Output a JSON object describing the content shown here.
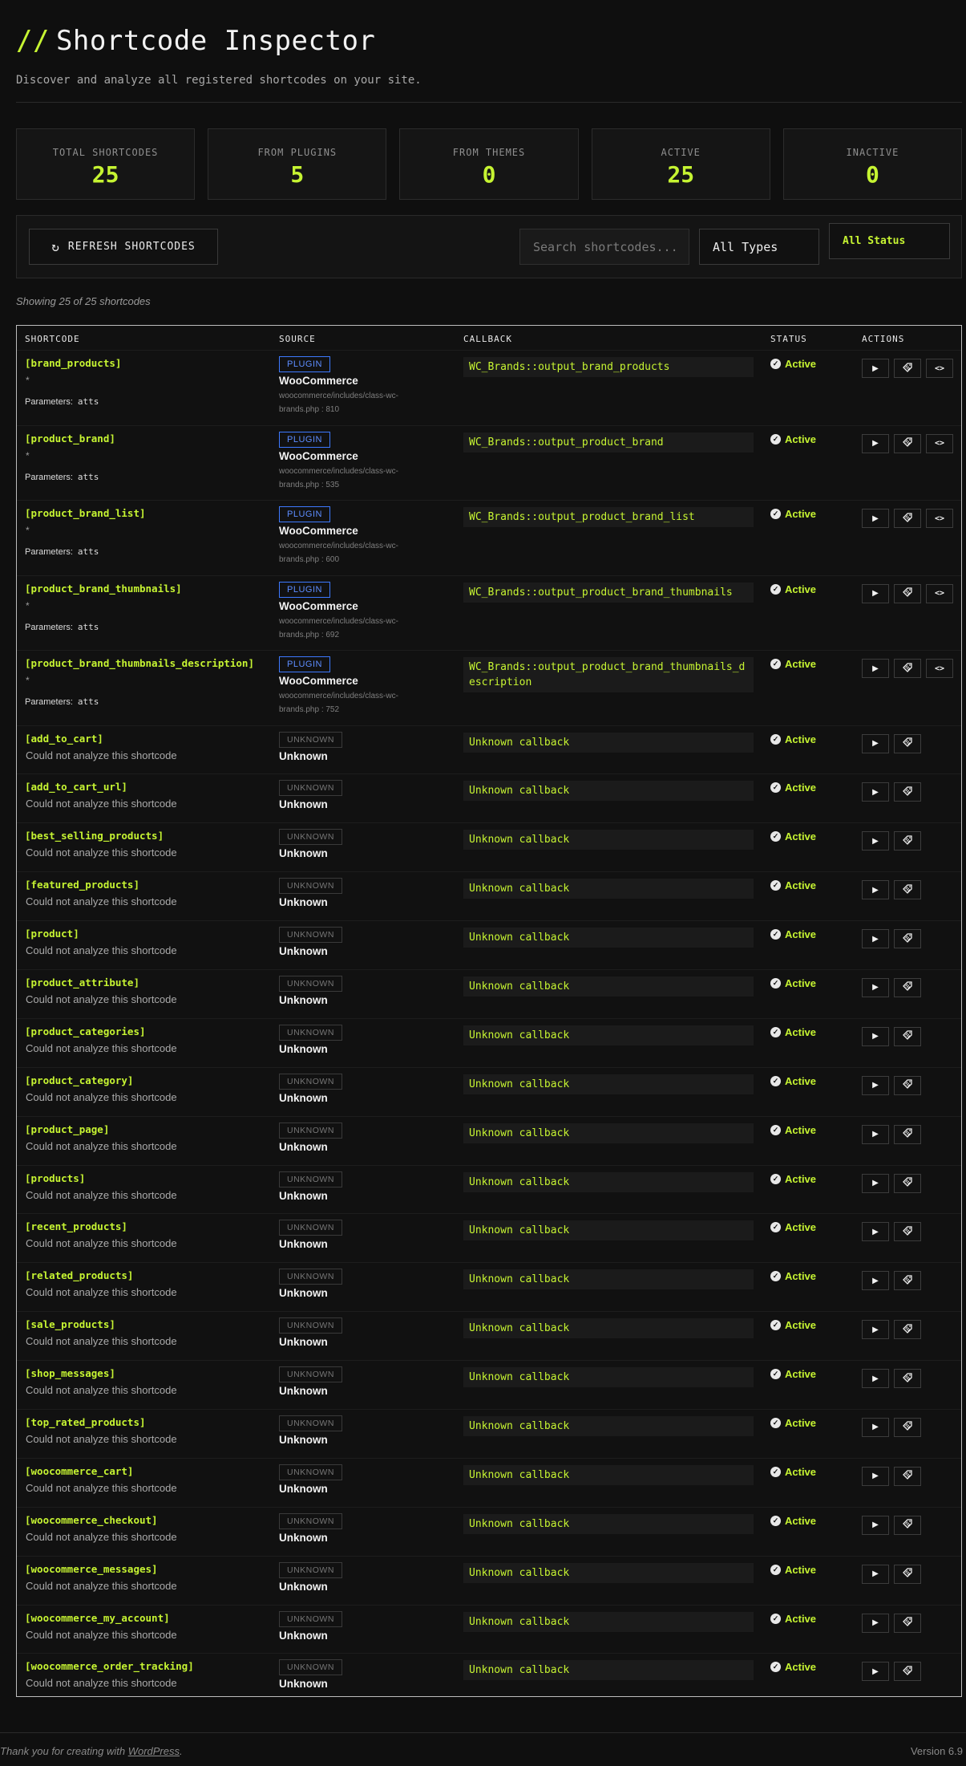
{
  "header": {
    "title_prefix": "//",
    "title": "Shortcode Inspector",
    "subtitle": "Discover and analyze all registered shortcodes on your site."
  },
  "stats": [
    {
      "label": "TOTAL SHORTCODES",
      "value": "25"
    },
    {
      "label": "FROM PLUGINS",
      "value": "5"
    },
    {
      "label": "FROM THEMES",
      "value": "0"
    },
    {
      "label": "ACTIVE",
      "value": "25"
    },
    {
      "label": "INACTIVE",
      "value": "0"
    }
  ],
  "toolbar": {
    "refresh_label": "REFRESH SHORTCODES",
    "search_placeholder": "Search shortcodes...",
    "type_filter": "All Types",
    "status_filter": "All Status"
  },
  "showing": "Showing 25 of 25 shortcodes",
  "table": {
    "columns": [
      "SHORTCODE",
      "SOURCE",
      "CALLBACK",
      "STATUS",
      "ACTIONS"
    ],
    "rows": [
      {
        "name": "[brand_products]",
        "star": "*",
        "params_label": "Parameters:",
        "params": "atts",
        "badge": "PLUGIN",
        "source": "WooCommerce",
        "path": "woocommerce/includes/class-wc-brands.php : 810",
        "callback": "WC_Brands::output_brand_products",
        "status": "Active"
      },
      {
        "name": "[product_brand]",
        "star": "*",
        "params_label": "Parameters:",
        "params": "atts",
        "badge": "PLUGIN",
        "source": "WooCommerce",
        "path": "woocommerce/includes/class-wc-brands.php : 535",
        "callback": "WC_Brands::output_product_brand",
        "status": "Active"
      },
      {
        "name": "[product_brand_list]",
        "star": "*",
        "params_label": "Parameters:",
        "params": "atts",
        "badge": "PLUGIN",
        "source": "WooCommerce",
        "path": "woocommerce/includes/class-wc-brands.php : 600",
        "callback": "WC_Brands::output_product_brand_list",
        "status": "Active"
      },
      {
        "name": "[product_brand_thumbnails]",
        "star": "*",
        "params_label": "Parameters:",
        "params": "atts",
        "badge": "PLUGIN",
        "source": "WooCommerce",
        "path": "woocommerce/includes/class-wc-brands.php : 692",
        "callback": "WC_Brands::output_product_brand_thumbnails",
        "status": "Active"
      },
      {
        "name": "[product_brand_thumbnails_description]",
        "star": "*",
        "params_label": "Parameters:",
        "params": "atts",
        "badge": "PLUGIN",
        "source": "WooCommerce",
        "path": "woocommerce/includes/class-wc-brands.php : 752",
        "callback": "WC_Brands::output_product_brand_thumbnails_description",
        "status": "Active"
      },
      {
        "name": "[add_to_cart]",
        "note": "Could not analyze this shortcode",
        "badge": "UNKNOWN",
        "source": "Unknown",
        "callback": "Unknown callback",
        "status": "Active"
      },
      {
        "name": "[add_to_cart_url]",
        "note": "Could not analyze this shortcode",
        "badge": "UNKNOWN",
        "source": "Unknown",
        "callback": "Unknown callback",
        "status": "Active"
      },
      {
        "name": "[best_selling_products]",
        "note": "Could not analyze this shortcode",
        "badge": "UNKNOWN",
        "source": "Unknown",
        "callback": "Unknown callback",
        "status": "Active"
      },
      {
        "name": "[featured_products]",
        "note": "Could not analyze this shortcode",
        "badge": "UNKNOWN",
        "source": "Unknown",
        "callback": "Unknown callback",
        "status": "Active"
      },
      {
        "name": "[product]",
        "note": "Could not analyze this shortcode",
        "badge": "UNKNOWN",
        "source": "Unknown",
        "callback": "Unknown callback",
        "status": "Active"
      },
      {
        "name": "[product_attribute]",
        "note": "Could not analyze this shortcode",
        "badge": "UNKNOWN",
        "source": "Unknown",
        "callback": "Unknown callback",
        "status": "Active"
      },
      {
        "name": "[product_categories]",
        "note": "Could not analyze this shortcode",
        "badge": "UNKNOWN",
        "source": "Unknown",
        "callback": "Unknown callback",
        "status": "Active"
      },
      {
        "name": "[product_category]",
        "note": "Could not analyze this shortcode",
        "badge": "UNKNOWN",
        "source": "Unknown",
        "callback": "Unknown callback",
        "status": "Active"
      },
      {
        "name": "[product_page]",
        "note": "Could not analyze this shortcode",
        "badge": "UNKNOWN",
        "source": "Unknown",
        "callback": "Unknown callback",
        "status": "Active"
      },
      {
        "name": "[products]",
        "note": "Could not analyze this shortcode",
        "badge": "UNKNOWN",
        "source": "Unknown",
        "callback": "Unknown callback",
        "status": "Active"
      },
      {
        "name": "[recent_products]",
        "note": "Could not analyze this shortcode",
        "badge": "UNKNOWN",
        "source": "Unknown",
        "callback": "Unknown callback",
        "status": "Active"
      },
      {
        "name": "[related_products]",
        "note": "Could not analyze this shortcode",
        "badge": "UNKNOWN",
        "source": "Unknown",
        "callback": "Unknown callback",
        "status": "Active"
      },
      {
        "name": "[sale_products]",
        "note": "Could not analyze this shortcode",
        "badge": "UNKNOWN",
        "source": "Unknown",
        "callback": "Unknown callback",
        "status": "Active"
      },
      {
        "name": "[shop_messages]",
        "note": "Could not analyze this shortcode",
        "badge": "UNKNOWN",
        "source": "Unknown",
        "callback": "Unknown callback",
        "status": "Active"
      },
      {
        "name": "[top_rated_products]",
        "note": "Could not analyze this shortcode",
        "badge": "UNKNOWN",
        "source": "Unknown",
        "callback": "Unknown callback",
        "status": "Active"
      },
      {
        "name": "[woocommerce_cart]",
        "note": "Could not analyze this shortcode",
        "badge": "UNKNOWN",
        "source": "Unknown",
        "callback": "Unknown callback",
        "status": "Active"
      },
      {
        "name": "[woocommerce_checkout]",
        "note": "Could not analyze this shortcode",
        "badge": "UNKNOWN",
        "source": "Unknown",
        "callback": "Unknown callback",
        "status": "Active"
      },
      {
        "name": "[woocommerce_messages]",
        "note": "Could not analyze this shortcode",
        "badge": "UNKNOWN",
        "source": "Unknown",
        "callback": "Unknown callback",
        "status": "Active"
      },
      {
        "name": "[woocommerce_my_account]",
        "note": "Could not analyze this shortcode",
        "badge": "UNKNOWN",
        "source": "Unknown",
        "callback": "Unknown callback",
        "status": "Active"
      },
      {
        "name": "[woocommerce_order_tracking]",
        "note": "Could not analyze this shortcode",
        "badge": "UNKNOWN",
        "source": "Unknown",
        "callback": "Unknown callback",
        "status": "Active"
      }
    ]
  },
  "icons": {
    "refresh": "refresh-icon",
    "check": "check-circle-icon",
    "run": "play-icon",
    "copy": "tag-icon",
    "code": "code-icon"
  },
  "colors": {
    "accent": "#c6f432",
    "plugin_badge": "#3d79ff",
    "background": "#0f0f0f"
  },
  "footer": {
    "thanks_prefix": "Thank you for creating with",
    "thanks_link": "WordPress",
    "thanks_suffix": ".",
    "version": "Version 6.9"
  }
}
